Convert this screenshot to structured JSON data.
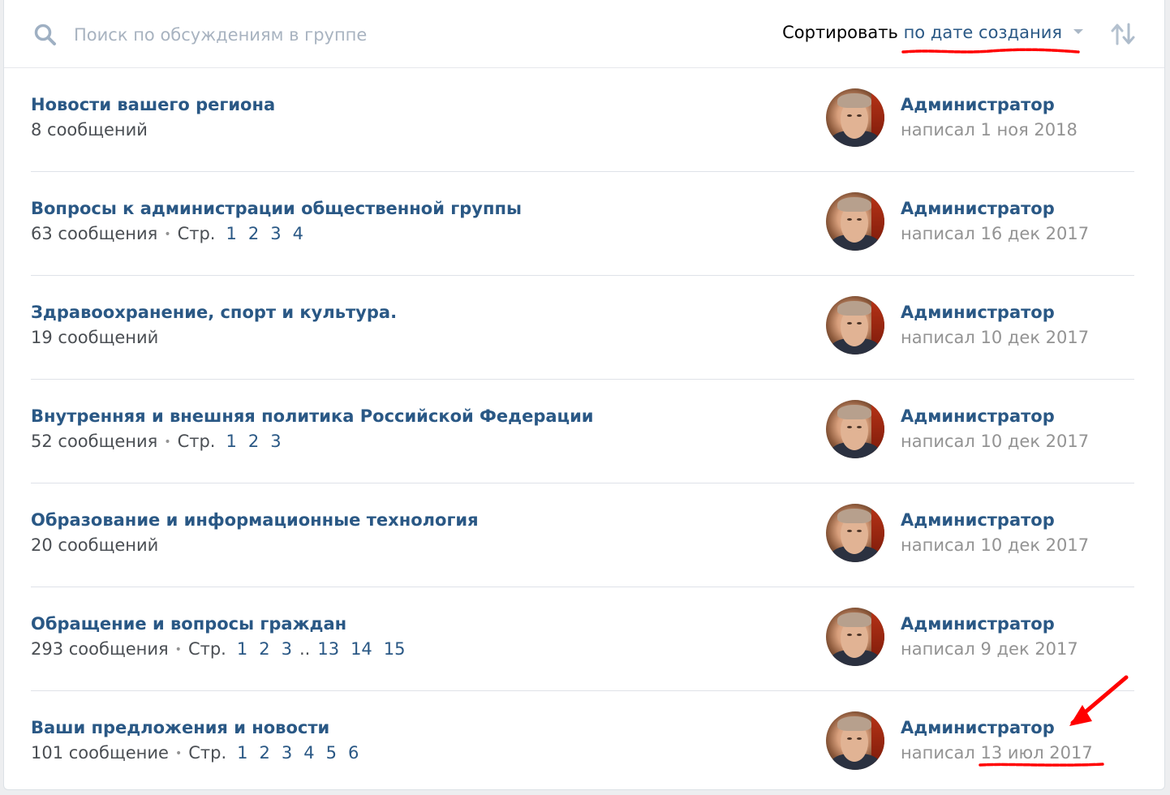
{
  "search": {
    "placeholder": "Поиск по обсуждениям в группе"
  },
  "sort": {
    "label": "Сортировать",
    "value": "по дате создания"
  },
  "colors": {
    "link": "#2a5885",
    "muted": "#939393",
    "annotation": "#ff0000"
  },
  "topics": [
    {
      "title": "Новости вашего региона",
      "count": "8 сообщений",
      "pages_label": "",
      "pages": [],
      "author": "Администратор",
      "written": "написал 1 ноя 2018"
    },
    {
      "title": "Вопросы к администрации общественной группы",
      "count": "63 сообщения",
      "pages_label": "Стр.",
      "pages": [
        "1",
        "2",
        "3",
        "4"
      ],
      "author": "Администратор",
      "written": "написал 16 дек 2017"
    },
    {
      "title": "Здравоохранение, спорт и культура.",
      "count": "19 сообщений",
      "pages_label": "",
      "pages": [],
      "author": "Администратор",
      "written": "написал 10 дек 2017"
    },
    {
      "title": "Внутренняя и внешняя политика Российской Федерации",
      "count": "52 сообщения",
      "pages_label": "Стр.",
      "pages": [
        "1",
        "2",
        "3"
      ],
      "author": "Администратор",
      "written": "написал 10 дек 2017"
    },
    {
      "title": "Образование и информационные технология",
      "count": "20 сообщений",
      "pages_label": "",
      "pages": [],
      "author": "Администратор",
      "written": "написал 10 дек 2017"
    },
    {
      "title": "Обращение и вопросы граждан",
      "count": "293 сообщения",
      "pages_label": "Стр.",
      "pages": [
        "1",
        "2",
        "3",
        "..",
        "13",
        "14",
        "15"
      ],
      "author": "Администратор",
      "written": "написал 9 дек 2017"
    },
    {
      "title": "Ваши предложения и новости",
      "count": "101 сообщение",
      "pages_label": "Стр.",
      "pages": [
        "1",
        "2",
        "3",
        "4",
        "5",
        "6"
      ],
      "author": "Администратор",
      "written": "написал 13 июл 2017"
    }
  ]
}
